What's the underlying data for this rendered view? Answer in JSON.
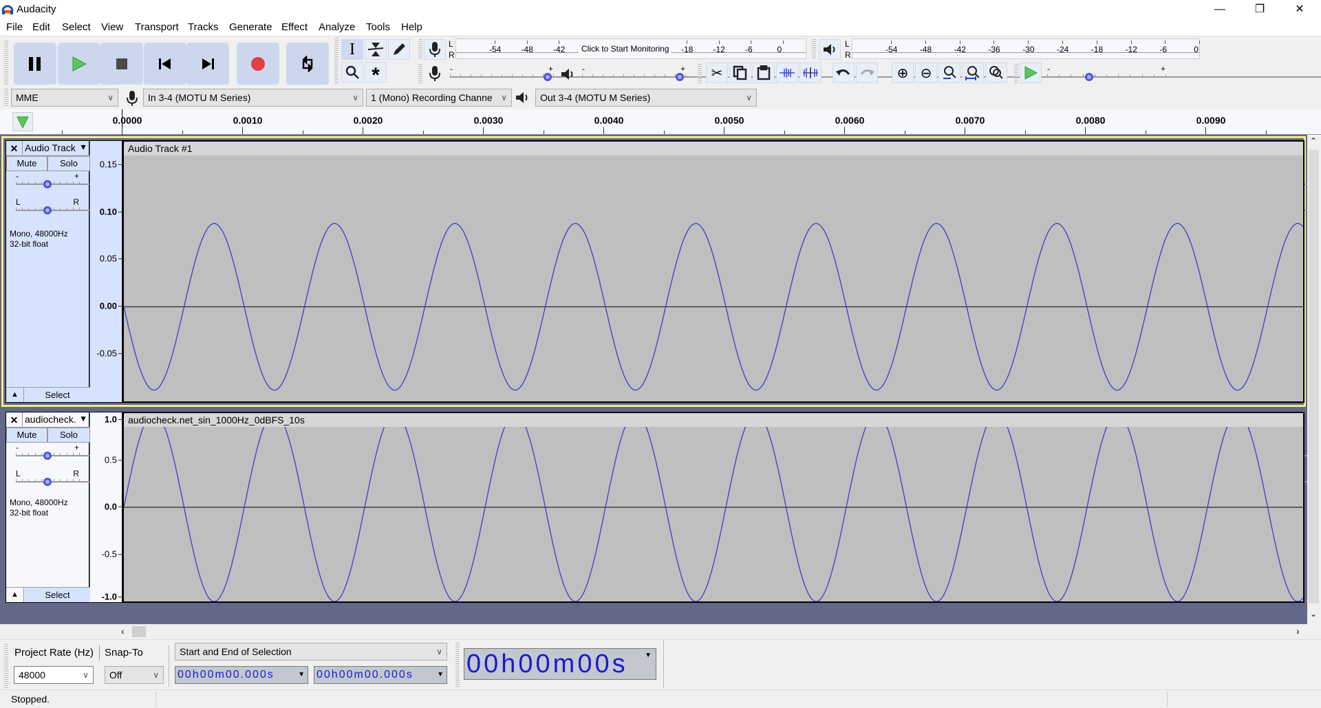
{
  "window": {
    "title": "Audacity",
    "minimize": "—",
    "restore": "❐",
    "close": "✕"
  },
  "menu": [
    "File",
    "Edit",
    "Select",
    "View",
    "Transport",
    "Tracks",
    "Generate",
    "Effect",
    "Analyze",
    "Tools",
    "Help"
  ],
  "transport": {
    "buttons": [
      "pause",
      "play",
      "stop",
      "skip-to-start",
      "skip-to-end",
      "record",
      "loop"
    ],
    "play_color": "#5cc45c",
    "record_color": "#e04040"
  },
  "tools": {
    "row1": [
      "selection",
      "envelope",
      "draw"
    ],
    "row2": [
      "zoom",
      "multi"
    ],
    "selected": "selection"
  },
  "recording_meter": {
    "channels": [
      "L",
      "R"
    ],
    "ticks": [
      "-54",
      "-48",
      "-42",
      "-18",
      "-12",
      "-6",
      "0"
    ],
    "prompt": "Click to Start Monitoring"
  },
  "playback_meter": {
    "channels": [
      "L",
      "R"
    ],
    "ticks": [
      "-54",
      "-48",
      "-42",
      "-36",
      "-30",
      "-24",
      "-18",
      "-12",
      "-6",
      "0"
    ]
  },
  "mixer": {
    "recording_volume": 1.0,
    "playback_volume": 1.0,
    "minus": "-",
    "plus": "+"
  },
  "edit_tools": [
    "cut",
    "copy",
    "paste",
    "trim",
    "silence",
    "undo",
    "redo"
  ],
  "zoom_tools": [
    "zoom-in",
    "zoom-out",
    "fit-selection",
    "fit-project",
    "zoom-toggle"
  ],
  "play_at_speed": {
    "speed_fraction": 0.35,
    "minus": "-",
    "plus": "+"
  },
  "devices": {
    "host": "MME",
    "input": "In 3-4 (MOTU M Series)",
    "channels": "1 (Mono) Recording Channe",
    "output": "Out 3-4 (MOTU M Series)"
  },
  "ruler": {
    "labels": [
      "0.0000",
      "0.0010",
      "0.0020",
      "0.0030",
      "0.0040",
      "0.0050",
      "0.0060",
      "0.0070",
      "0.0080",
      "0.0090"
    ]
  },
  "tracks": [
    {
      "name": "Audio Track",
      "clip_name": "Audio Track #1",
      "mute": "Mute",
      "solo": "Solo",
      "gain_minus": "-",
      "gain_plus": "+",
      "pan_left": "L",
      "pan_right": "R",
      "info1": "Mono, 48000Hz",
      "info2": "32-bit float",
      "select": "Select",
      "scale_labels": [
        "0.15",
        "0.10",
        "0.05",
        "0.00",
        "-0.05"
      ],
      "scale_values": [
        0.15,
        0.1,
        0.05,
        0.0,
        -0.05
      ],
      "ymin": -0.1,
      "ymax": 0.16,
      "amplitude": 0.088,
      "frequency_hz": 1000,
      "phase": "inverted",
      "focused": true
    },
    {
      "name": "audiocheck.",
      "clip_name": "audiocheck.net_sin_1000Hz_0dBFS_10s",
      "mute": "Mute",
      "solo": "Solo",
      "gain_minus": "-",
      "gain_plus": "+",
      "pan_left": "L",
      "pan_right": "R",
      "info1": "Mono, 48000Hz",
      "info2": "32-bit float",
      "select": "Select",
      "scale_labels": [
        "1.0",
        "0.5",
        "0.0",
        "-0.5",
        "-1.0"
      ],
      "scale_values": [
        1.0,
        0.5,
        0.0,
        -0.5,
        -1.0
      ],
      "ymin": -1.0,
      "ymax": 1.0,
      "amplitude": 1.0,
      "frequency_hz": 1000,
      "phase": "normal",
      "focused": false
    }
  ],
  "selection_toolbar": {
    "project_rate_label": "Project Rate (Hz)",
    "project_rate": "48000",
    "snap_to_label": "Snap-To",
    "snap_to": "Off",
    "selection_mode": "Start and End of Selection",
    "start": "00h00m00.000s",
    "end": "00h00m00.000s"
  },
  "time_display": "00h00m00s",
  "status": "Stopped."
}
